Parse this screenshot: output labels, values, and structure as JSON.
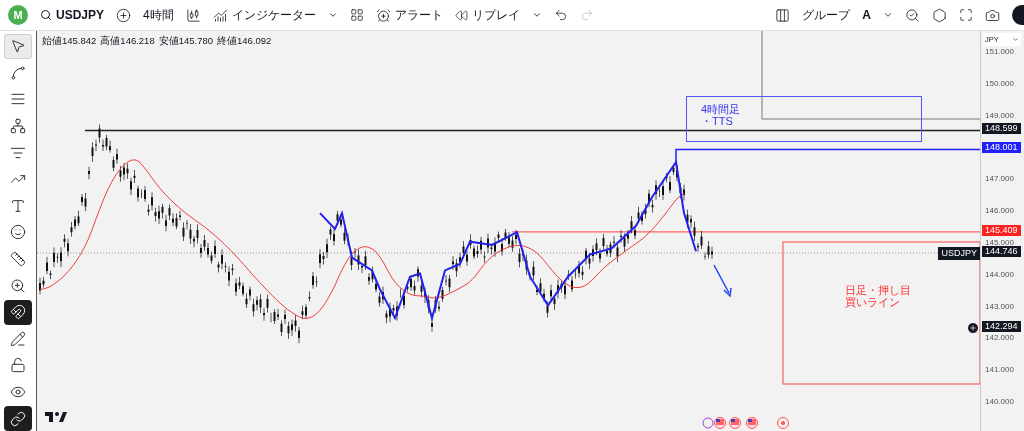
{
  "toolbar": {
    "avatar": "M",
    "symbol": "USDJPY",
    "interval": "4時間",
    "indicators": "インジケーター",
    "alert": "アラート",
    "replay": "リプレイ",
    "group": "グループ",
    "group_letter": "A"
  },
  "tools": [
    {
      "kind": "cursor",
      "selected": true,
      "on": false
    },
    {
      "kind": "trendline",
      "selected": false,
      "on": false
    },
    {
      "kind": "fib",
      "selected": false,
      "on": false
    },
    {
      "kind": "pattern",
      "selected": false,
      "on": false
    },
    {
      "kind": "forecast",
      "selected": false,
      "on": false
    },
    {
      "kind": "brush",
      "selected": false,
      "on": false
    },
    {
      "kind": "text",
      "selected": false,
      "on": false
    },
    {
      "kind": "emoji",
      "selected": false,
      "on": false
    },
    {
      "kind": "ruler",
      "selected": false,
      "on": false
    },
    {
      "kind": "zoom",
      "selected": false,
      "on": false
    },
    {
      "kind": "magnet",
      "selected": false,
      "on": true
    },
    {
      "kind": "lockdraw",
      "selected": false,
      "on": false
    },
    {
      "kind": "lock",
      "selected": false,
      "on": false
    },
    {
      "kind": "eye",
      "selected": false,
      "on": false
    },
    {
      "kind": "link",
      "selected": false,
      "on": true
    }
  ],
  "ohlc": [
    "始値145.842",
    "高値146.218",
    "安値145.780",
    "終値146.092"
  ],
  "axis": {
    "currency": "JPY",
    "ticks": [
      "151.000",
      "150.000",
      "149.000",
      "147.000",
      "146.000",
      "145.000",
      "144.000",
      "143.000",
      "142.000",
      "141.000",
      "140.000"
    ]
  },
  "price_tags": [
    {
      "text": "148.599",
      "color": "#131722"
    },
    {
      "text": "148.001",
      "color": "#2020ff"
    },
    {
      "text": "145.409",
      "color": "#ff2020"
    }
  ],
  "symbol_tag": {
    "name": "USDJPY",
    "price": "144.746"
  },
  "crosshair_tag": {
    "price": "142.294"
  },
  "notes": [
    {
      "kind": "box",
      "lines": [
        "4時間足",
        "・TTS"
      ]
    },
    {
      "kind": "plain",
      "lines": [
        "日足・押し目",
        "買いライン"
      ]
    }
  ]
}
